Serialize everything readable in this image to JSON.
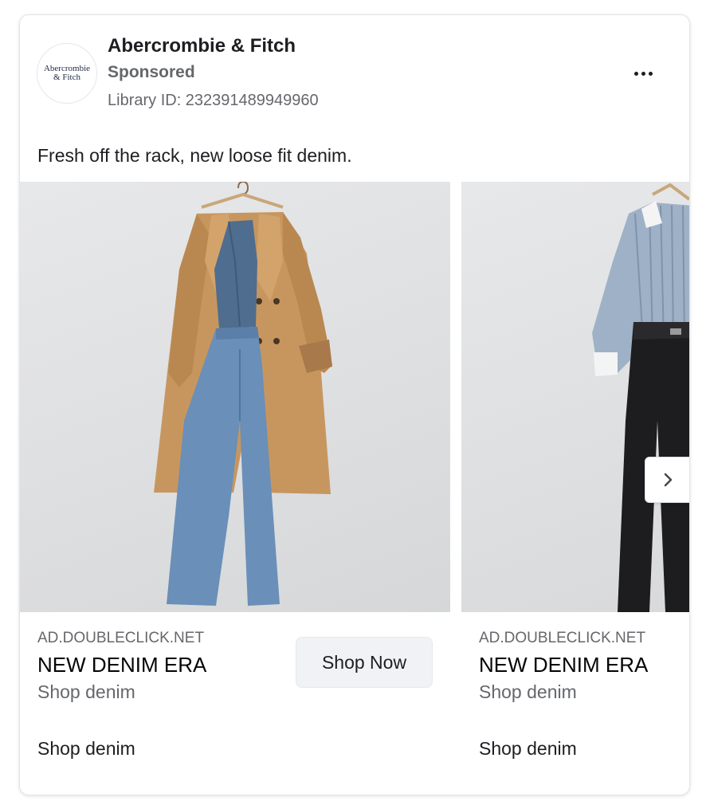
{
  "advertiser": {
    "name": "Abercrombie & Fitch",
    "sponsored_label": "Sponsored",
    "library_id": "Library ID: 232391489949960",
    "avatar_logo_line1": "Abercrombie",
    "avatar_logo_line2": "& Fitch"
  },
  "post": {
    "body_text": "Fresh off the rack, new loose fit denim."
  },
  "carousel": {
    "cards": [
      {
        "domain": "AD.DOUBLECLICK.NET",
        "headline": "NEW DENIM ERA",
        "description": "Shop denim",
        "cta_label": "Shop Now",
        "footer_text": "Shop denim",
        "image": "trench-coat-denim-vest-jeans"
      },
      {
        "domain": "AD.DOUBLECLICK.NET",
        "headline": "NEW DENIM ERA",
        "description": "Shop denim",
        "footer_text": "Shop denim",
        "image": "striped-shirt-black-jeans"
      }
    ]
  },
  "icons": {
    "more": "more-options-icon",
    "next": "chevron-right-icon"
  },
  "colors": {
    "text_primary": "#1c1e21",
    "text_secondary": "#65676b",
    "button_bg": "#f0f2f5"
  }
}
